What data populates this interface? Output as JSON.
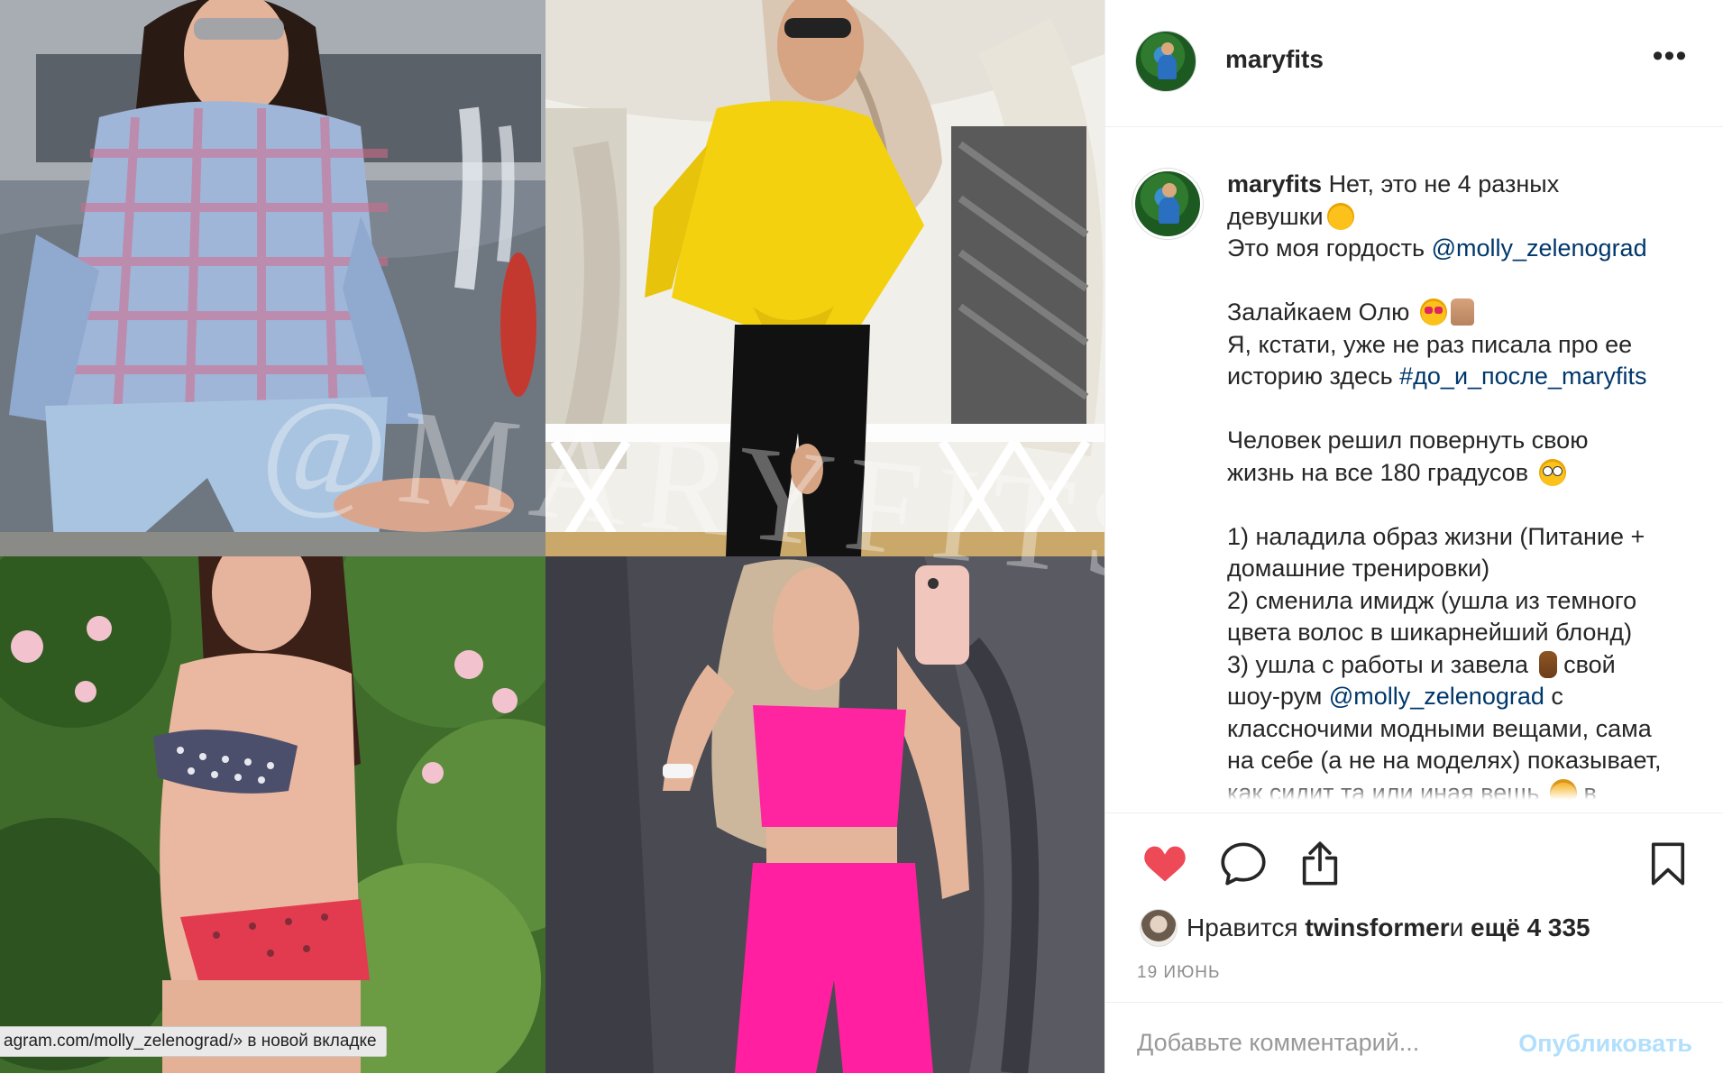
{
  "post": {
    "username": "maryfits",
    "more_label": "•••"
  },
  "photos": {
    "watermark": "@MARYFITS"
  },
  "status_bar": {
    "url_text": "agram.com/molly_zelenograd/» в новой вкладке"
  },
  "caption": {
    "username": "maryfits",
    "l1": "Нет, это не 4 разных",
    "l2": "девушки",
    "l3_text": "Это моя гордость ",
    "l3_mention": "@molly_zelenograd",
    "l4": "Залайкаем Олю",
    "l5": "Я, кстати, уже не раз писала про ее",
    "l6_text": "историю здесь ",
    "l6_hashtag": "#до_и_после_maryfits",
    "l7": "Человек решил повернуть свою",
    "l8": "жизнь на все 180 градусов",
    "l9": "1) наладила образ жизни (Питание +",
    "l10": "домашние тренировки)",
    "l11": "2) сменила имидж (ушла из темного",
    "l12": "цвета волос в шикарнейший блонд)",
    "l13_text": "3) ушла с работы и завела",
    "l13_tail": "свой",
    "l14_text": "шоу-рум ",
    "l14_mention": "@molly_zelenograd",
    "l14_tail": " с",
    "l15": "классночими модными вещами, сама",
    "l16": "на себе (а не на моделях) показывает,",
    "l17_text": "как сидит та или иная вещь",
    "l17_tail": "в"
  },
  "actions": {
    "like_icon": "heart-filled",
    "comment_icon": "comment-bubble",
    "share_icon": "share-arrow",
    "save_icon": "bookmark",
    "like_color": "#ed4956"
  },
  "likes": {
    "prefix": "Нравится ",
    "user": "twinsformer",
    "middle": " и ",
    "count": "ещё 4 335"
  },
  "date": "19 июнь",
  "comment": {
    "placeholder": "Добавьте комментарий...",
    "publish_label": "Опубликовать"
  },
  "colors": {
    "link": "#00376b",
    "publish_disabled": "#b2dffc",
    "muted": "#8e8e8e"
  }
}
